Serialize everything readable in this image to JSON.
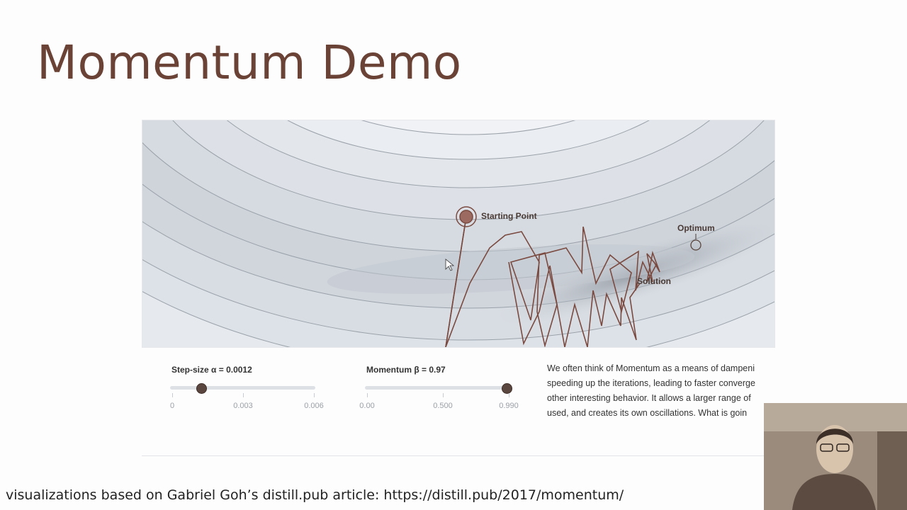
{
  "slide": {
    "title": "Momentum Demo",
    "caption": "visualizations based on Gabriel Goh’s distill.pub article: https://distill.pub/2017/momentum/"
  },
  "plot": {
    "start_label": "Starting Point",
    "optimum_label": "Optimum",
    "solution_label": "Solution"
  },
  "step_size": {
    "label": "Step-size α = 0.0012",
    "value": 0.0012,
    "min": 0,
    "max": 0.006,
    "ticks": [
      "0",
      "0.003",
      "0.006"
    ]
  },
  "momentum": {
    "label": "Momentum β = 0.97",
    "value": 0.97,
    "min": 0,
    "max": 0.99,
    "ticks": [
      "0.00",
      "0.500",
      "0.990"
    ]
  },
  "description": {
    "lines": [
      "We often think of Momentum as a means of dampeni",
      "speeding up the iterations, leading to faster converge",
      "other interesting behavior. It allows a larger range of",
      "used, and creates its own oscillations. What is goin"
    ]
  },
  "colors": {
    "title": "#6b4236",
    "path": "#7a4a40",
    "thumb": "#5a463f"
  }
}
